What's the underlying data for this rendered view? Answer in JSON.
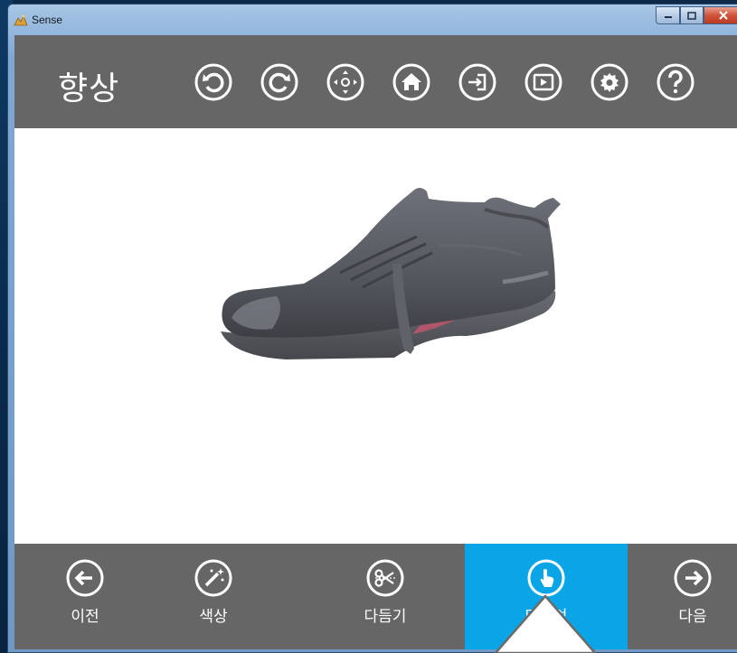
{
  "window": {
    "title": "Sense"
  },
  "header": {
    "title": "향상"
  },
  "toolbar": {
    "items": [
      {
        "icon": "rotate-left-icon"
      },
      {
        "icon": "rotate-right-icon"
      },
      {
        "icon": "move-icon"
      },
      {
        "icon": "home-icon"
      },
      {
        "icon": "import-icon"
      },
      {
        "icon": "play-icon"
      },
      {
        "icon": "settings-icon"
      },
      {
        "icon": "help-icon"
      }
    ]
  },
  "viewport": {
    "object": "3D scanned shoe model"
  },
  "bottom_nav": {
    "items": [
      {
        "label": "이전",
        "icon": "arrow-left-icon",
        "active": false
      },
      {
        "label": "색상",
        "icon": "magic-wand-icon",
        "active": false
      },
      {
        "label": "다듬기",
        "icon": "scissors-icon",
        "active": false
      },
      {
        "label": "터치업",
        "icon": "touch-icon",
        "active": true
      },
      {
        "label": "다음",
        "icon": "arrow-right-icon",
        "active": false
      }
    ]
  },
  "colors": {
    "bar": "#666666",
    "accent": "#0aa5e6",
    "viewport_bg": "#ffffff"
  }
}
